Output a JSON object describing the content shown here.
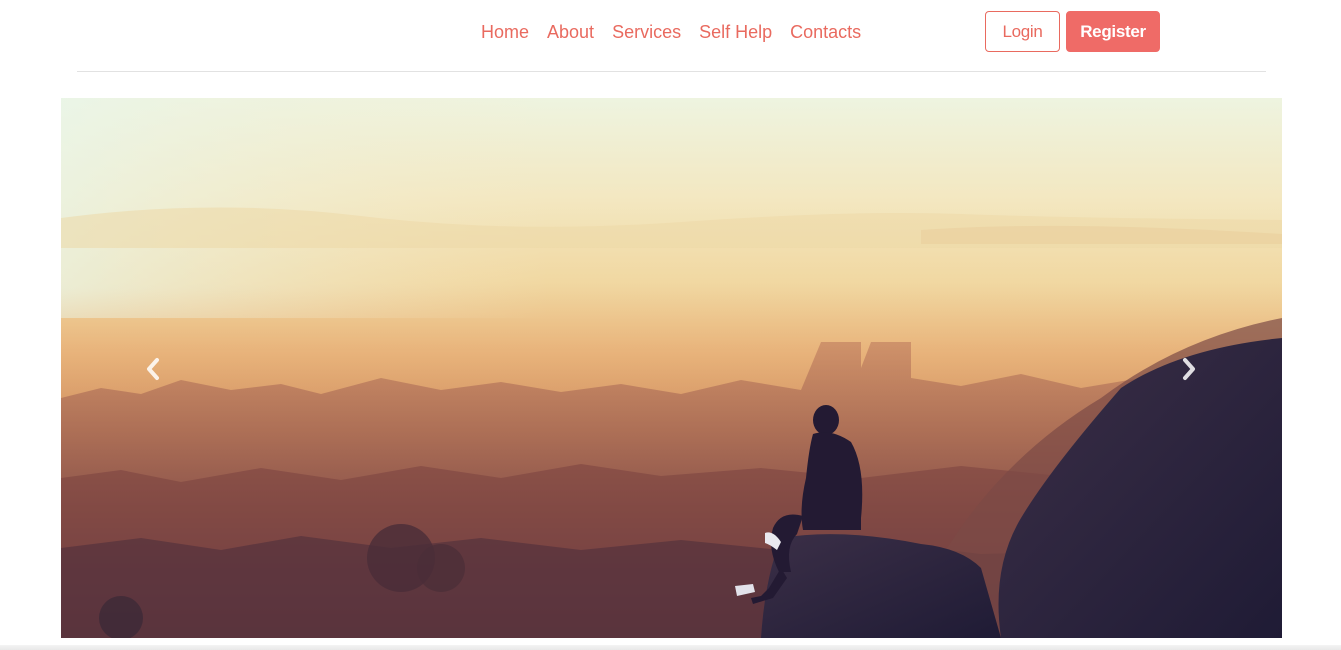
{
  "nav": {
    "items": [
      {
        "label": "Home"
      },
      {
        "label": "About"
      },
      {
        "label": "Services"
      },
      {
        "label": "Self Help"
      },
      {
        "label": "Contacts"
      }
    ]
  },
  "auth": {
    "login_label": "Login",
    "register_label": "Register"
  },
  "carousel": {
    "prev_icon": "chevron-left-icon",
    "next_icon": "chevron-right-icon"
  },
  "colors": {
    "accent": "#e96a5f",
    "register_bg": "#ef6b67",
    "divider": "#e2e2e2"
  }
}
